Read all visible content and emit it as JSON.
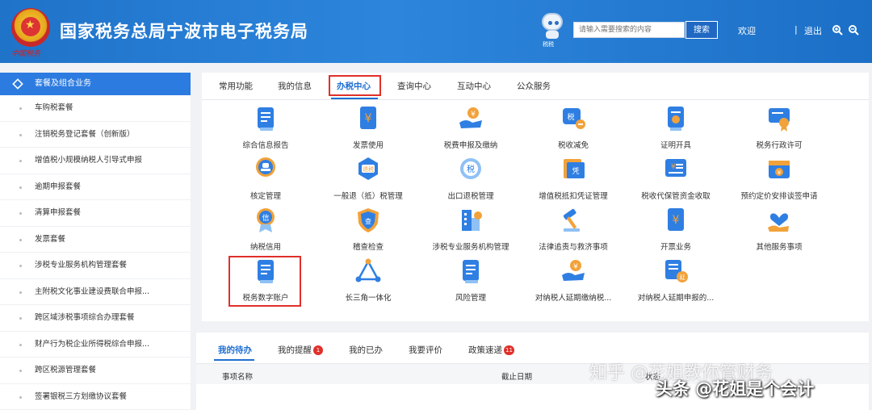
{
  "header": {
    "seal_text": "中国税务",
    "title": "国家税务总局宁波市电子税务局",
    "robot_label": "税税",
    "search_placeholder": "请输入需要搜索的内容",
    "search_button": "搜索",
    "welcome": "欢迎",
    "separator": "|",
    "logout": "退出",
    "zoom_in_icon": "zoom-in-icon",
    "zoom_out_icon": "zoom-out-icon"
  },
  "sidebar": {
    "header": "套餐及组合业务",
    "items": [
      {
        "label": "车购税套餐"
      },
      {
        "label": "注销税务登记套餐（创新版）"
      },
      {
        "label": "增值税小规模纳税人引导式申报"
      },
      {
        "label": "逾期申报套餐"
      },
      {
        "label": "清算申报套餐"
      },
      {
        "label": "发票套餐"
      },
      {
        "label": "涉税专业服务机构管理套餐"
      },
      {
        "label": "主附税文化事业建设费联合申报..."
      },
      {
        "label": "跨区域涉税事项综合办理套餐"
      },
      {
        "label": "财产行为税企业所得税综合申报..."
      },
      {
        "label": "跨区税源管理套餐"
      },
      {
        "label": "签署银税三方划缴协议套餐"
      }
    ]
  },
  "tabs": [
    {
      "label": "常用功能"
    },
    {
      "label": "我的信息"
    },
    {
      "label": "办税中心",
      "active": true
    },
    {
      "label": "查询中心"
    },
    {
      "label": "互动中心"
    },
    {
      "label": "公众服务"
    }
  ],
  "services": [
    {
      "label": "综合信息报告",
      "icon": "report-icon"
    },
    {
      "label": "发票使用",
      "icon": "invoice-yen-icon"
    },
    {
      "label": "税费申报及缴纳",
      "icon": "hand-coin-icon"
    },
    {
      "label": "税收减免",
      "icon": "tax-reduction-icon"
    },
    {
      "label": "证明开具",
      "icon": "certificate-icon"
    },
    {
      "label": "税务行政许可",
      "icon": "license-icon"
    },
    {
      "label": "核定管理",
      "icon": "stamp-icon"
    },
    {
      "label": "一般退（抵）税管理",
      "icon": "refund-icon"
    },
    {
      "label": "出口退税管理",
      "icon": "export-refund-icon"
    },
    {
      "label": "增值税抵扣凭证管理",
      "icon": "voucher-icon"
    },
    {
      "label": "税收代保管资金收取",
      "icon": "deposit-icon"
    },
    {
      "label": "预约定价安排谈签申请",
      "icon": "pricing-icon"
    },
    {
      "label": "纳税信用",
      "icon": "credit-medal-icon"
    },
    {
      "label": "稽查检查",
      "icon": "inspect-shield-icon"
    },
    {
      "label": "涉税专业服务机构管理",
      "icon": "building-icon"
    },
    {
      "label": "法律追责与救济事项",
      "icon": "gavel-icon"
    },
    {
      "label": "开票业务",
      "icon": "billing-icon"
    },
    {
      "label": "其他服务事项",
      "icon": "heart-hand-icon"
    },
    {
      "label": "税务数字账户",
      "icon": "digital-account-icon",
      "highlight": true
    },
    {
      "label": "长三角一体化",
      "icon": "triangle-icon"
    },
    {
      "label": "风险管理",
      "icon": "risk-icon"
    },
    {
      "label": "对纳税人延期缴纳税...",
      "icon": "deferred-payment-icon"
    },
    {
      "label": "对纳税人延期申报的...",
      "icon": "deferred-filing-icon"
    }
  ],
  "bottom_tabs": [
    {
      "label": "我的待办",
      "active": true,
      "badge": ""
    },
    {
      "label": "我的提醒",
      "badge": "1"
    },
    {
      "label": "我的已办",
      "badge": ""
    },
    {
      "label": "我要评价",
      "badge": ""
    },
    {
      "label": "政策速递",
      "badge": "11"
    }
  ],
  "table_headers": [
    "事项名称",
    "截止日期",
    "状态"
  ],
  "watermarks": [
    "知乎 @花姐教你管财务",
    "头条 @花姐是个会计"
  ],
  "colors": {
    "header_blue": "#2a7fd8",
    "accent_blue": "#1f6fd1",
    "highlight_red": "#e0302a"
  }
}
